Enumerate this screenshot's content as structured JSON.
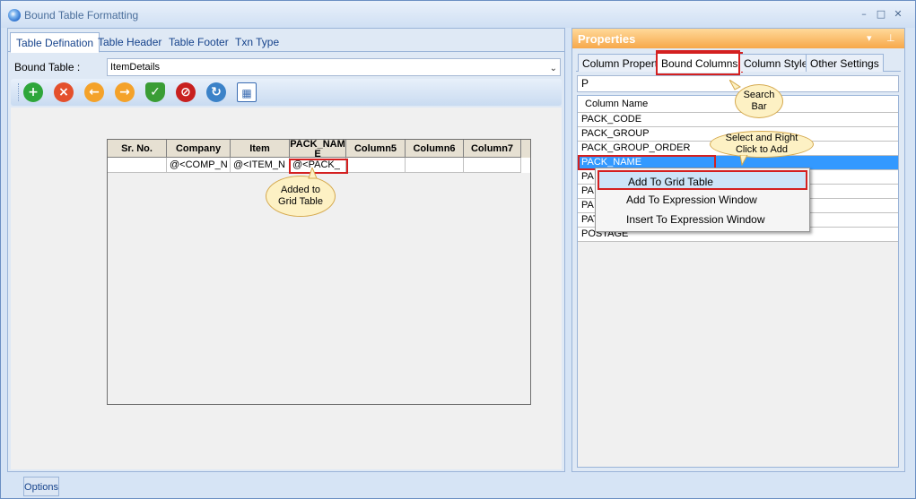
{
  "window": {
    "title": "Bound Table Formatting",
    "controls": {
      "minimize": "–",
      "maximize": "□",
      "close": "✕"
    }
  },
  "left_panel": {
    "tabs": [
      {
        "label": "Table Defination",
        "active": true
      },
      {
        "label": "Table Header",
        "active": false
      },
      {
        "label": "Table Footer",
        "active": false
      },
      {
        "label": "Txn Type",
        "active": false
      }
    ],
    "bound_table_label": "Bound Table :",
    "bound_table_value": "ItemDetails",
    "toolbar": [
      {
        "name": "add-icon",
        "color": "#2ea63a"
      },
      {
        "name": "delete-icon",
        "color": "#e4502c"
      },
      {
        "name": "arrow-left-icon",
        "color": "#f4a22a"
      },
      {
        "name": "arrow-right-icon",
        "color": "#f4a22a"
      },
      {
        "name": "shield-check-icon",
        "color": "#3a9d35"
      },
      {
        "name": "stop-icon",
        "color": "#c8201f"
      },
      {
        "name": "refresh-icon",
        "color": "#3b82c8"
      },
      {
        "name": "layout-icon",
        "color": "#3a6cb2"
      }
    ],
    "grid": {
      "columns": [
        "Sr. No.",
        "Company",
        "Item",
        "PACK_NAME",
        "Column5",
        "Column6",
        "Column7"
      ],
      "row": [
        "",
        "@<COMP_N",
        "@<ITEM_N",
        "@<PACK_",
        "",
        "",
        ""
      ]
    },
    "callout_added": "Added to Grid Table"
  },
  "right_panel": {
    "title": "Properties",
    "header_controls": {
      "dropdown": "▾",
      "pin": "⊥"
    },
    "tabs": [
      {
        "label": "Column Property",
        "active": false
      },
      {
        "label": "Bound Columns",
        "active": true
      },
      {
        "label": "Column Style",
        "active": false
      },
      {
        "label": "Other Settings",
        "active": false
      }
    ],
    "search_value": "P",
    "list_header": "Column Name",
    "columns": [
      {
        "label": "PACK_CODE",
        "selected": false
      },
      {
        "label": "PACK_GROUP",
        "selected": false
      },
      {
        "label": "PACK_GROUP_ORDER",
        "selected": false
      },
      {
        "label": "PACK_NAME",
        "selected": true
      },
      {
        "label": "PA",
        "selected": false
      },
      {
        "label": "PA",
        "selected": false
      },
      {
        "label": "PA",
        "selected": false
      },
      {
        "label": "PAT",
        "selected": false
      },
      {
        "label": "POSTAGE",
        "selected": false
      }
    ],
    "callout_search": "Search Bar",
    "callout_select": "Select and Right Click to Add"
  },
  "context_menu": {
    "items": [
      {
        "label": "Add To Grid Table",
        "hover": true
      },
      {
        "label": "Add To Expression Window",
        "hover": false
      },
      {
        "label": "Insert To Expression Window",
        "hover": false
      }
    ]
  },
  "bottom": {
    "options_label": "Options"
  }
}
